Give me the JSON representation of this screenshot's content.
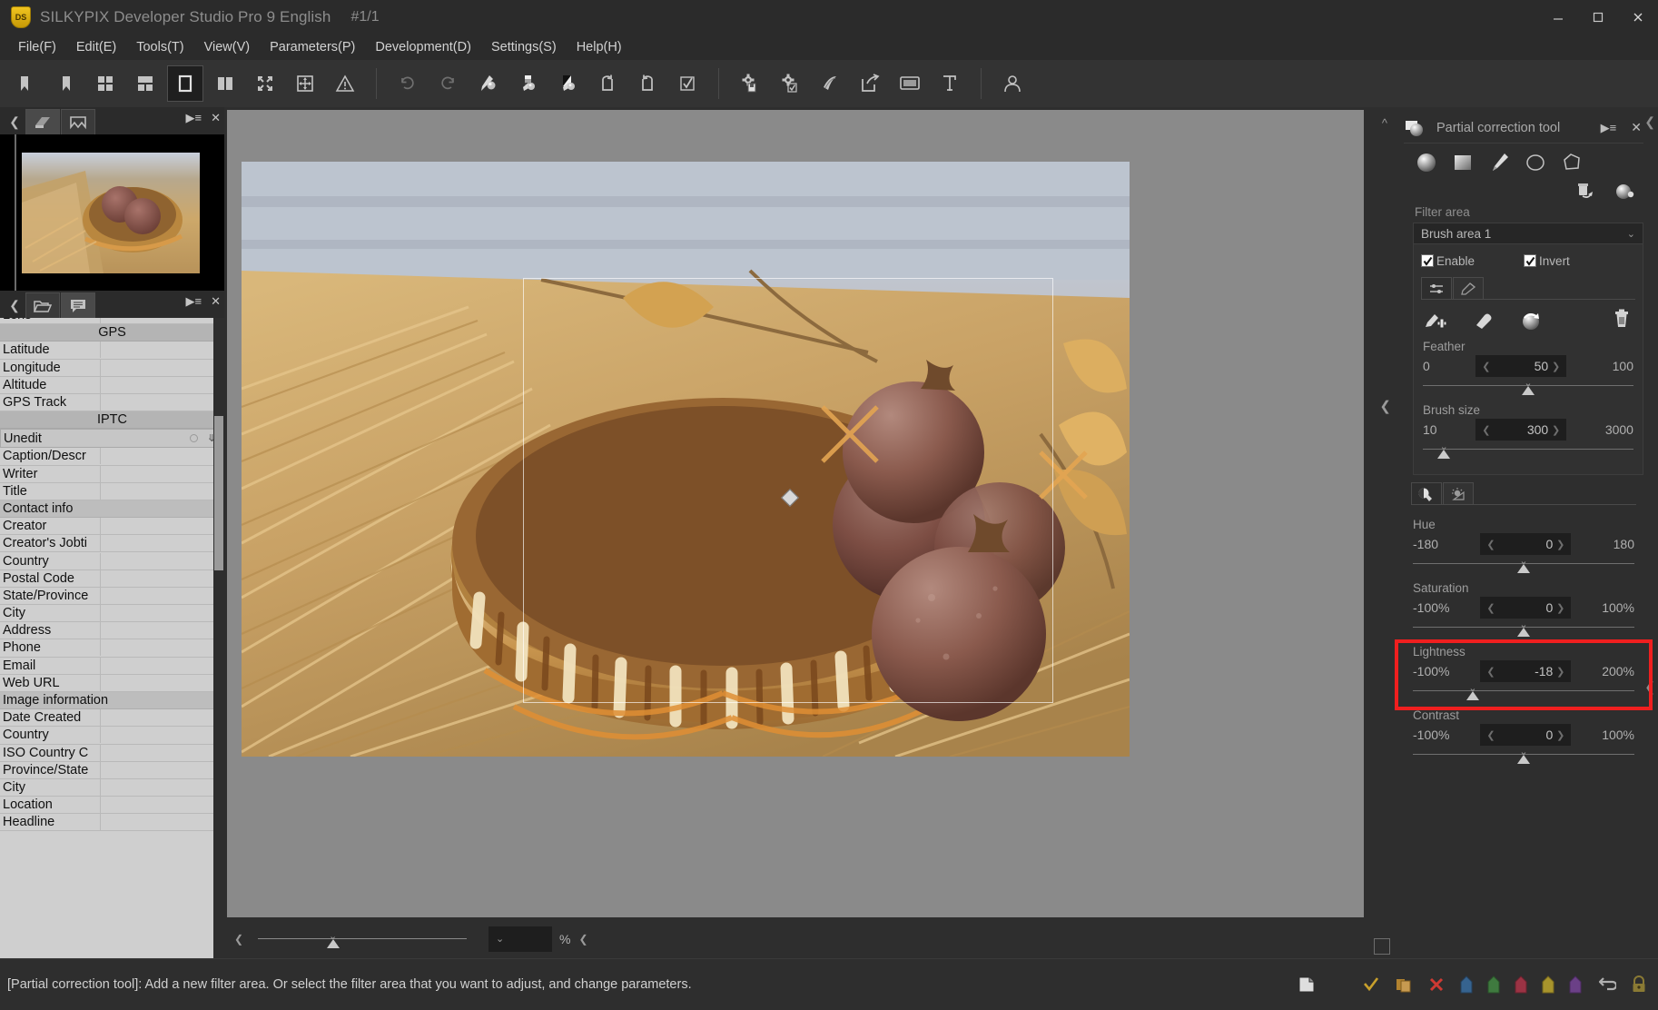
{
  "window": {
    "app_title": "SILKYPIX Developer Studio Pro 9 English",
    "image_counter": "#1/1",
    "logo_text": "DS",
    "minimize_label": "Minimize",
    "maximize_label": "Maximize",
    "close_label": "Close"
  },
  "menubar": {
    "items": [
      {
        "label": "File(F)"
      },
      {
        "label": "Edit(E)"
      },
      {
        "label": "Tools(T)"
      },
      {
        "label": "View(V)"
      },
      {
        "label": "Parameters(P)"
      },
      {
        "label": "Development(D)"
      },
      {
        "label": "Settings(S)"
      },
      {
        "label": "Help(H)"
      }
    ]
  },
  "toolbar": {
    "buttons": [
      {
        "name": "previous-image-icon",
        "tooltip": "Previous image"
      },
      {
        "name": "next-image-icon",
        "tooltip": "Next image"
      },
      {
        "name": "thumbnail-grid-icon",
        "tooltip": "Thumbnail view"
      },
      {
        "name": "thumbnail-list-icon",
        "tooltip": "Combination view"
      },
      {
        "name": "single-image-icon",
        "tooltip": "Single image view",
        "active": true
      },
      {
        "name": "compare-two-icon",
        "tooltip": "Compare two images"
      },
      {
        "name": "fullscreen-icon",
        "tooltip": "Full screen"
      },
      {
        "name": "fit-window-icon",
        "tooltip": "Fit to window"
      },
      {
        "name": "warning-icon",
        "tooltip": "Warning display"
      },
      {
        "name": "undo-icon",
        "tooltip": "Undo"
      },
      {
        "name": "redo-icon",
        "tooltip": "Redo"
      },
      {
        "name": "white-balance-picker-icon",
        "tooltip": "White balance"
      },
      {
        "name": "gray-balance-picker-icon",
        "tooltip": "Gray balance"
      },
      {
        "name": "black-white-picker-icon",
        "tooltip": "Black and white point"
      },
      {
        "name": "rotate-left-icon",
        "tooltip": "Rotate left"
      },
      {
        "name": "rotate-right-icon",
        "tooltip": "Rotate right"
      },
      {
        "name": "checkmark-box-icon",
        "tooltip": "Mark"
      },
      {
        "name": "develop-settings-icon",
        "tooltip": "Development settings"
      },
      {
        "name": "batch-develop-icon",
        "tooltip": "Batch development"
      },
      {
        "name": "taste-icon",
        "tooltip": "Taste"
      },
      {
        "name": "export-icon",
        "tooltip": "Export"
      },
      {
        "name": "slideshow-icon",
        "tooltip": "Slideshow"
      },
      {
        "name": "printer-icon",
        "tooltip": "Print"
      },
      {
        "name": "user-profile-icon",
        "tooltip": "User"
      }
    ]
  },
  "left_panel": {
    "thumb_tabs": [
      {
        "name": "tab-thumbnail-view",
        "selected": true
      },
      {
        "name": "tab-filmstrip-view",
        "selected": false
      }
    ],
    "meta_tabs": [
      {
        "name": "tab-folder-browser",
        "selected": false
      },
      {
        "name": "tab-metadata",
        "selected": true
      }
    ],
    "menu_icon": "list-menu-icon",
    "close_icon": "close-icon",
    "back_icon": "chevron-left-icon",
    "metadata": {
      "partial_top_row": "Lens",
      "rows": [
        {
          "type": "group",
          "label": "GPS"
        },
        {
          "type": "item",
          "label": "Latitude",
          "value": ""
        },
        {
          "type": "item",
          "label": "Longitude",
          "value": ""
        },
        {
          "type": "item",
          "label": "Altitude",
          "value": ""
        },
        {
          "type": "item",
          "label": "GPS Track",
          "value": ""
        },
        {
          "type": "group",
          "label": "IPTC"
        },
        {
          "type": "select",
          "label": "Unedit",
          "value": ""
        },
        {
          "type": "item",
          "label": "Caption/Descr",
          "value": ""
        },
        {
          "type": "item",
          "label": "Writer",
          "value": ""
        },
        {
          "type": "item",
          "label": "Title",
          "value": ""
        },
        {
          "type": "sub",
          "label": "Contact info"
        },
        {
          "type": "item",
          "label": "Creator",
          "value": ""
        },
        {
          "type": "item",
          "label": "Creator's Jobti",
          "value": ""
        },
        {
          "type": "item",
          "label": "Country",
          "value": ""
        },
        {
          "type": "item",
          "label": "Postal Code",
          "value": ""
        },
        {
          "type": "item",
          "label": "State/Province",
          "value": ""
        },
        {
          "type": "item",
          "label": "City",
          "value": ""
        },
        {
          "type": "item",
          "label": "Address",
          "value": ""
        },
        {
          "type": "item",
          "label": "Phone",
          "value": ""
        },
        {
          "type": "item",
          "label": "Email",
          "value": ""
        },
        {
          "type": "item",
          "label": "Web URL",
          "value": ""
        },
        {
          "type": "sub",
          "label": "Image information"
        },
        {
          "type": "item",
          "label": "Date Created",
          "value": ""
        },
        {
          "type": "item",
          "label": "Country",
          "value": ""
        },
        {
          "type": "item",
          "label": "ISO Country C",
          "value": ""
        },
        {
          "type": "item",
          "label": "Province/State",
          "value": ""
        },
        {
          "type": "item",
          "label": "City",
          "value": ""
        },
        {
          "type": "item",
          "label": "Location",
          "value": ""
        },
        {
          "type": "item",
          "label": "Headline",
          "value": ""
        }
      ]
    }
  },
  "viewer": {
    "zoom_unit": "%",
    "zoom_value": "",
    "exposure_slider_value": 33
  },
  "right_panel": {
    "title": "Partial correction tool",
    "menu_icon": "list-menu-icon",
    "close_icon": "close-icon",
    "tools": [
      {
        "name": "circular-gradient-tool-icon",
        "label": "Circular gradient"
      },
      {
        "name": "linear-gradient-tool-icon",
        "label": "Linear gradient"
      },
      {
        "name": "brush-tool-icon",
        "label": "Brush"
      },
      {
        "name": "ellipse-tool-icon",
        "label": "Ellipse"
      },
      {
        "name": "polygon-tool-icon",
        "label": "Polygon"
      }
    ],
    "filter_area_label": "Filter area",
    "filter_area_value": "Brush area 1",
    "reset-icon-label": "Reset filter",
    "preview-icon-label": "Preview mask",
    "enable_label": "Enable",
    "enable_checked": true,
    "invert_label": "Invert",
    "invert_checked": true,
    "subtabs": [
      {
        "name": "subtab-parameters",
        "selected": true
      },
      {
        "name": "subtab-mask-paint",
        "selected": false
      }
    ],
    "brush_actions": [
      {
        "name": "brush-add-icon",
        "label": "Add with brush"
      },
      {
        "name": "eraser-icon",
        "label": "Erase"
      },
      {
        "name": "refresh-mask-icon",
        "label": "Reset mask"
      },
      {
        "name": "trash-icon",
        "label": "Delete filter area"
      }
    ],
    "brush_sliders": [
      {
        "name": "feather",
        "label": "Feather",
        "min": "0",
        "max": "100",
        "value": "50",
        "pct": 50
      },
      {
        "name": "brush-size",
        "label": "Brush size",
        "min": "10",
        "max": "3000",
        "value": "300",
        "pct": 10
      }
    ],
    "adjust_tabs": [
      {
        "name": "adjust-tab-tone",
        "selected": true
      },
      {
        "name": "adjust-tab-light",
        "selected": false
      }
    ],
    "adjust_sliders": [
      {
        "name": "hue",
        "label": "Hue",
        "min": "-180",
        "max": "180",
        "value": "0",
        "pct": 50,
        "highlight": false
      },
      {
        "name": "saturation",
        "label": "Saturation",
        "min": "-100%",
        "max": "100%",
        "value": "0",
        "pct": 50,
        "highlight": false
      },
      {
        "name": "lightness",
        "label": "Lightness",
        "min": "-100%",
        "max": "200%",
        "value": "-18",
        "pct": 27,
        "highlight": true
      },
      {
        "name": "contrast",
        "label": "Contrast",
        "min": "-100%",
        "max": "100%",
        "value": "0",
        "pct": 50,
        "highlight": false
      }
    ],
    "highlight_color": "#f01f1f"
  },
  "statusbar": {
    "message": "[Partial correction tool]: Add a new filter area. Or select the filter area that you want to adjust, and change parameters.",
    "icons": [
      {
        "name": "page-layout-icon",
        "color": "#cccccc"
      },
      {
        "name": "check-mark-icon",
        "color": "#c8a02c"
      },
      {
        "name": "copy-icon",
        "color": "#b1822f"
      },
      {
        "name": "delete-x-icon",
        "color": "#cf3a33"
      },
      {
        "name": "tag-blue-icon",
        "color": "#36638f"
      },
      {
        "name": "tag-green-icon",
        "color": "#3f7a3f"
      },
      {
        "name": "tag-red-icon",
        "color": "#9b3344"
      },
      {
        "name": "tag-yellow-icon",
        "color": "#a8942c"
      },
      {
        "name": "tag-purple-icon",
        "color": "#6b4087"
      },
      {
        "name": "undo-arrow-icon",
        "color": "#b0b0b0"
      },
      {
        "name": "lock-icon",
        "color": "#8a7a34"
      }
    ]
  }
}
